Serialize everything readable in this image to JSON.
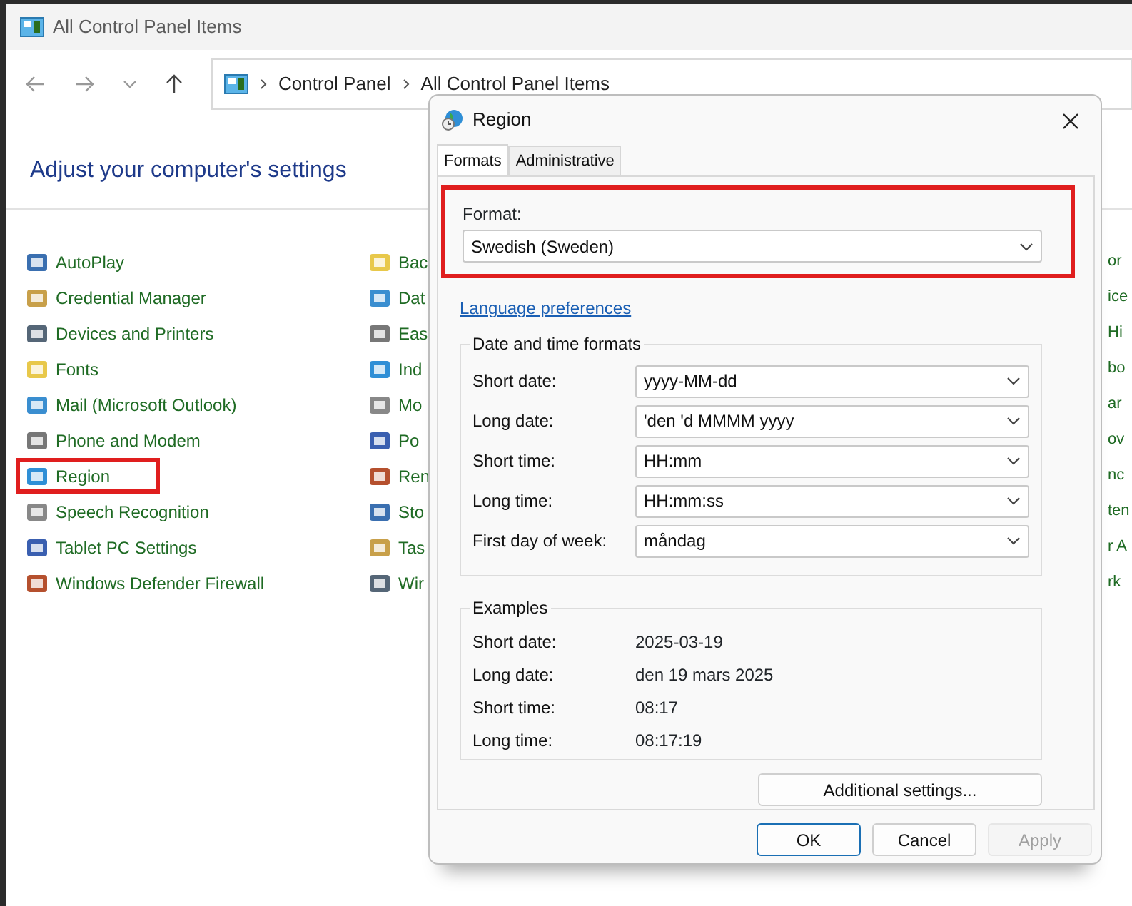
{
  "window": {
    "title": "All Control Panel Items"
  },
  "address_bar": {
    "breadcrumbs": [
      "Control Panel",
      "All Control Panel Items"
    ]
  },
  "heading": "Adjust your computer's settings",
  "items_column_1": [
    {
      "label": "AutoPlay",
      "highlighted": false
    },
    {
      "label": "Credential Manager",
      "highlighted": false
    },
    {
      "label": "Devices and Printers",
      "highlighted": false
    },
    {
      "label": "Fonts",
      "highlighted": false
    },
    {
      "label": "Mail (Microsoft Outlook)",
      "highlighted": false
    },
    {
      "label": "Phone and Modem",
      "highlighted": false
    },
    {
      "label": "Region",
      "highlighted": true
    },
    {
      "label": "Speech Recognition",
      "highlighted": false
    },
    {
      "label": "Tablet PC Settings",
      "highlighted": false
    },
    {
      "label": "Windows Defender Firewall",
      "highlighted": false
    }
  ],
  "items_column_2": [
    {
      "label": "Bac"
    },
    {
      "label": "Dat"
    },
    {
      "label": "Eas"
    },
    {
      "label": "Ind"
    },
    {
      "label": "Mo"
    },
    {
      "label": "Po"
    },
    {
      "label": "Ren"
    },
    {
      "label": "Sto"
    },
    {
      "label": "Tas"
    },
    {
      "label": "Wir"
    }
  ],
  "items_column_3": [
    {
      "label": "or"
    },
    {
      "label": "ice"
    },
    {
      "label": "Hi"
    },
    {
      "label": "bo"
    },
    {
      "label": "ar"
    },
    {
      "label": "ov"
    },
    {
      "label": "nc"
    },
    {
      "label": "ten"
    },
    {
      "label": "r A"
    },
    {
      "label": "rk"
    }
  ],
  "dialog": {
    "title": "Region",
    "tabs": [
      {
        "label": "Formats",
        "selected": true
      },
      {
        "label": "Administrative",
        "selected": false
      }
    ],
    "format": {
      "label": "Format:",
      "value": "Swedish (Sweden)",
      "highlighted": true
    },
    "link": "Language preferences",
    "date_time_formats": {
      "title": "Date and time formats",
      "fields": [
        {
          "label": "Short date:",
          "value": "yyyy-MM-dd"
        },
        {
          "label": "Long date:",
          "value": "'den 'd MMMM yyyy"
        },
        {
          "label": "Short time:",
          "value": "HH:mm"
        },
        {
          "label": "Long time:",
          "value": "HH:mm:ss"
        },
        {
          "label": "First day of week:",
          "value": "måndag"
        }
      ]
    },
    "examples": {
      "title": "Examples",
      "rows": [
        {
          "label": "Short date:",
          "value": "2025-03-19"
        },
        {
          "label": "Long date:",
          "value": "den 19 mars 2025"
        },
        {
          "label": "Short time:",
          "value": "08:17"
        },
        {
          "label": "Long time:",
          "value": "08:17:19"
        }
      ]
    },
    "additional_button": "Additional settings...",
    "buttons": [
      {
        "label": "OK",
        "default": true,
        "disabled": false
      },
      {
        "label": "Cancel",
        "default": false,
        "disabled": false
      },
      {
        "label": "Apply",
        "default": false,
        "disabled": true
      }
    ]
  }
}
